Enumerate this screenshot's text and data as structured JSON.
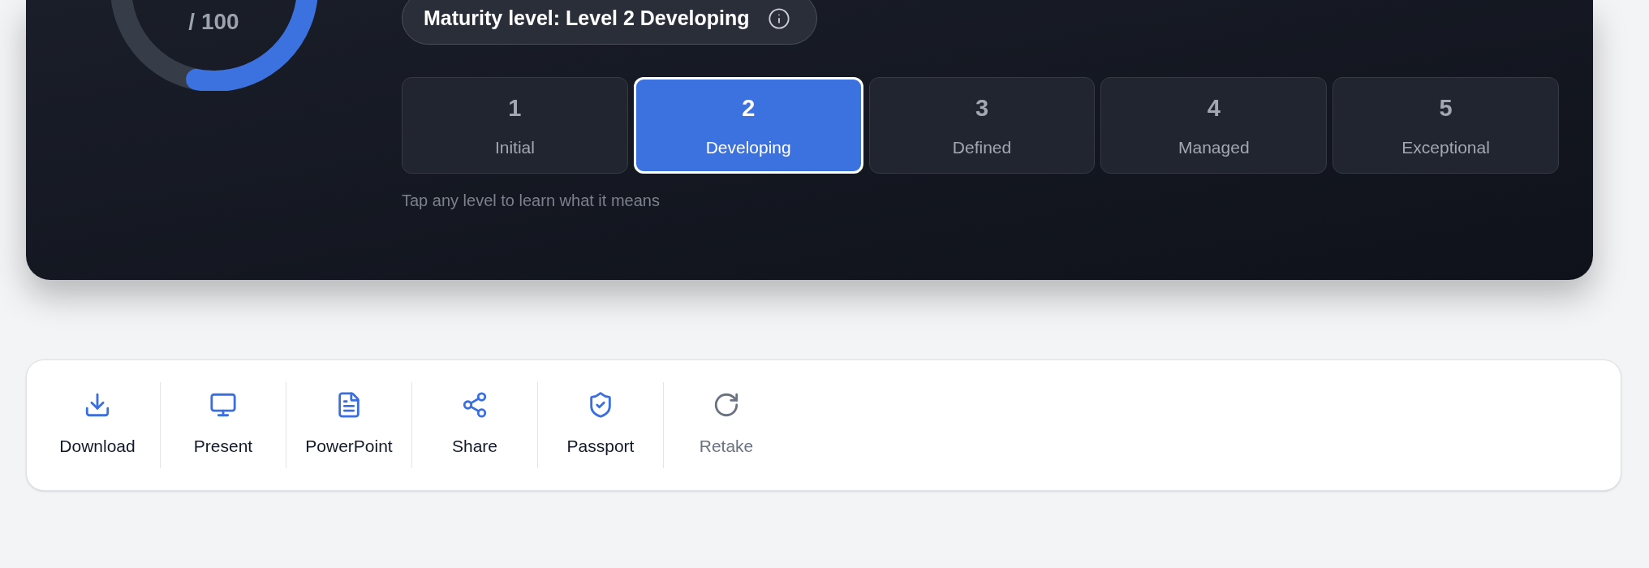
{
  "score": {
    "suffix": "/ 100"
  },
  "maturity": {
    "label": "Maturity level: Level 2 Developing"
  },
  "levels": [
    {
      "number": "1",
      "name": "Initial",
      "selected": false
    },
    {
      "number": "2",
      "name": "Developing",
      "selected": true
    },
    {
      "number": "3",
      "name": "Defined",
      "selected": false
    },
    {
      "number": "4",
      "name": "Managed",
      "selected": false
    },
    {
      "number": "5",
      "name": "Exceptional",
      "selected": false
    }
  ],
  "levels_hint": "Tap any level to learn what it means",
  "actions": [
    {
      "kind": "download",
      "label": "Download",
      "muted": false
    },
    {
      "kind": "present",
      "label": "Present",
      "muted": false
    },
    {
      "kind": "powerpoint",
      "label": "PowerPoint",
      "muted": false
    },
    {
      "kind": "share",
      "label": "Share",
      "muted": false
    },
    {
      "kind": "passport",
      "label": "Passport",
      "muted": false
    },
    {
      "kind": "retake",
      "label": "Retake",
      "muted": true
    }
  ]
}
